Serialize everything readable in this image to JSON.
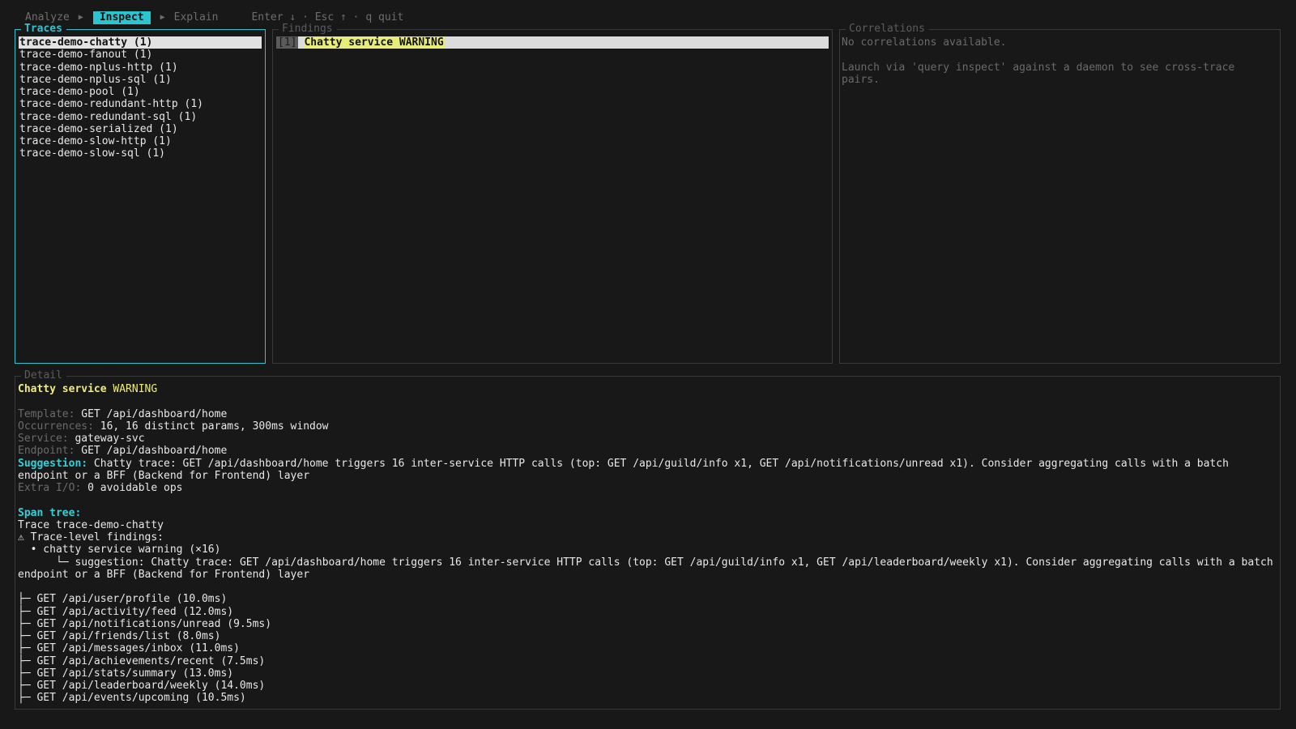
{
  "header": {
    "tabs": [
      {
        "label": "Analyze",
        "active": false
      },
      {
        "label": "Inspect",
        "active": true
      },
      {
        "label": "Explain",
        "active": false
      }
    ],
    "separator": "▶",
    "hint": "Enter ↓ · Esc ↑ · q quit"
  },
  "traces": {
    "title": "Traces",
    "items": [
      "trace-demo-chatty (1)",
      "trace-demo-fanout (1)",
      "trace-demo-nplus-http (1)",
      "trace-demo-nplus-sql (1)",
      "trace-demo-pool (1)",
      "trace-demo-redundant-http (1)",
      "trace-demo-redundant-sql (1)",
      "trace-demo-serialized (1)",
      "trace-demo-slow-http (1)",
      "trace-demo-slow-sql (1)"
    ],
    "selected_index": 0
  },
  "findings": {
    "title": "Findings",
    "items": [
      {
        "index": "[1]",
        "label": "Chatty service WARNING"
      }
    ]
  },
  "correlations": {
    "title": "Correlations",
    "empty": "No correlations available.",
    "hint": "Launch via 'query inspect' against a daemon to see cross-trace pairs."
  },
  "detail": {
    "title": "Detail",
    "heading_name": "Chatty service",
    "heading_severity": "WARNING",
    "fields": {
      "template_label": "Template:",
      "template": "GET /api/dashboard/home",
      "occurrences_label": "Occurrences:",
      "occurrences": "16, 16 distinct params, 300ms window",
      "service_label": "Service:",
      "service": "gateway-svc",
      "endpoint_label": "Endpoint:",
      "endpoint": "GET /api/dashboard/home",
      "suggestion_label": "Suggestion:",
      "suggestion": "Chatty trace: GET /api/dashboard/home triggers 16 inter-service HTTP calls (top: GET /api/guild/info x1, GET /api/notifications/unread x1). Consider aggregating calls with a batch endpoint or a BFF (Backend for Frontend) layer",
      "extra_io_label": "Extra I/O:",
      "extra_io": "0 avoidable ops"
    },
    "span_tree_label": "Span tree:",
    "trace_line": "Trace trace-demo-chatty",
    "trace_findings_line": "⚠ Trace-level findings:",
    "finding_bullet": "  • chatty service warning (×16)",
    "finding_suggestion": "      └─ suggestion: Chatty trace: GET /api/dashboard/home triggers 16 inter-service HTTP calls (top: GET /api/guild/info x1, GET /api/leaderboard/weekly x1). Consider aggregating calls with a batch endpoint or a BFF (Backend for Frontend) layer",
    "spans": [
      "├─ GET /api/user/profile (10.0ms)",
      "├─ GET /api/activity/feed (12.0ms)",
      "├─ GET /api/notifications/unread (9.5ms)",
      "├─ GET /api/friends/list (8.0ms)",
      "├─ GET /api/messages/inbox (11.0ms)",
      "├─ GET /api/achievements/recent (7.5ms)",
      "├─ GET /api/stats/summary (13.0ms)",
      "├─ GET /api/leaderboard/weekly (14.0ms)",
      "├─ GET /api/events/upcoming (10.5ms)"
    ]
  },
  "colors": {
    "background": "#181818",
    "accent": "#2fc3cc",
    "warning": "#eded7a",
    "border": "#3a3a3a"
  }
}
